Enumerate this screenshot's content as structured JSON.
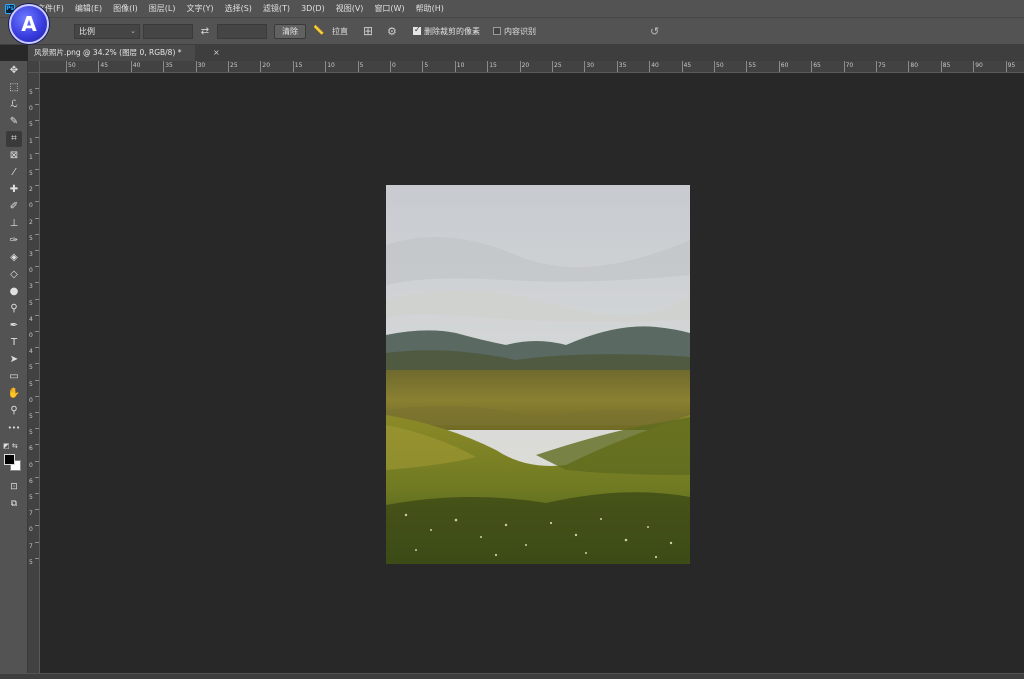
{
  "menu": {
    "items": [
      "文件(F)",
      "编辑(E)",
      "图像(I)",
      "图层(L)",
      "文字(Y)",
      "选择(S)",
      "滤镜(T)",
      "3D(D)",
      "视图(V)",
      "窗口(W)",
      "帮助(H)"
    ]
  },
  "app_logo": {
    "letter": "A"
  },
  "options": {
    "ratio_value": "比例",
    "clear_label": "清除",
    "straighten_label": "拉直",
    "delete_cropped_label": "删除裁剪的像素",
    "delete_cropped_checked": true,
    "content_aware_label": "内容识别",
    "content_aware_checked": false
  },
  "document": {
    "tab_title": "风景照片.png @ 34.2% (图层 0, RGB/8) *",
    "close_glyph": "×"
  },
  "ruler_h": [
    "50",
    "45",
    "40",
    "35",
    "30",
    "25",
    "20",
    "15",
    "10",
    "5",
    "0",
    "5",
    "10",
    "15",
    "20",
    "25",
    "30",
    "35",
    "40",
    "45",
    "50",
    "55",
    "60",
    "65",
    "70",
    "75",
    "80",
    "85",
    "90",
    "95"
  ],
  "ruler_v": [
    "5",
    "0",
    "5",
    "1",
    "1",
    "5",
    "2",
    "0",
    "2",
    "5",
    "3",
    "0",
    "3",
    "5",
    "4",
    "0",
    "4",
    "5",
    "5",
    "0",
    "5",
    "5",
    "6",
    "0",
    "6",
    "5",
    "7",
    "0",
    "7",
    "5"
  ],
  "tools": [
    {
      "name": "move-tool-icon",
      "glyph": "✥"
    },
    {
      "name": "marquee-tool-icon",
      "glyph": "⬚"
    },
    {
      "name": "lasso-tool-icon",
      "glyph": "ℒ"
    },
    {
      "name": "quick-select-tool-icon",
      "glyph": "✎"
    },
    {
      "name": "crop-tool-icon",
      "glyph": "⌗"
    },
    {
      "name": "frame-tool-icon",
      "glyph": "⊠"
    },
    {
      "name": "eyedropper-tool-icon",
      "glyph": "⁄"
    },
    {
      "name": "healing-tool-icon",
      "glyph": "✚"
    },
    {
      "name": "brush-tool-icon",
      "glyph": "✐"
    },
    {
      "name": "stamp-tool-icon",
      "glyph": "⊥"
    },
    {
      "name": "history-brush-tool-icon",
      "glyph": "✑"
    },
    {
      "name": "eraser-tool-icon",
      "glyph": "◈"
    },
    {
      "name": "bucket-tool-icon",
      "glyph": "◇"
    },
    {
      "name": "blur-tool-icon",
      "glyph": "●"
    },
    {
      "name": "dodge-tool-icon",
      "glyph": "⚲"
    },
    {
      "name": "pen-tool-icon",
      "glyph": "✒"
    },
    {
      "name": "type-tool-icon",
      "glyph": "T"
    },
    {
      "name": "path-select-tool-icon",
      "glyph": "➤"
    },
    {
      "name": "rectangle-tool-icon",
      "glyph": "▭"
    },
    {
      "name": "hand-tool-icon",
      "glyph": "✋"
    },
    {
      "name": "zoom-tool-icon",
      "glyph": "⚲"
    },
    {
      "name": "more-tools-icon",
      "glyph": "•••"
    }
  ],
  "colors": {
    "foreground": "#000000",
    "background": "#ffffff"
  }
}
